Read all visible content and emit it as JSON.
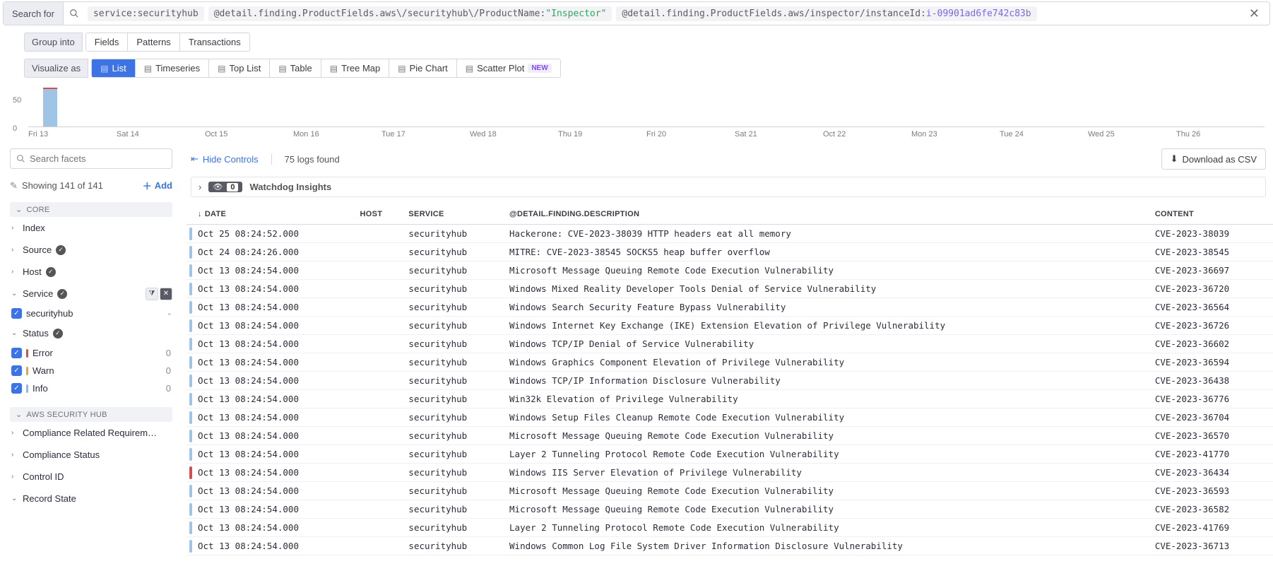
{
  "search": {
    "label": "Search for",
    "chips": [
      {
        "key": "service",
        "val": "securityhub",
        "kind": "plain"
      },
      {
        "key": "@detail.finding.ProductFields.aws\\/securityhub\\/ProductName",
        "val": "\"Inspector\"",
        "kind": "string"
      },
      {
        "key": "@detail.finding.ProductFields.aws/inspector/instanceId",
        "val": "i-09901ad6fe742c83b",
        "kind": "id"
      }
    ]
  },
  "group_into": {
    "label": "Group into",
    "items": [
      "Fields",
      "Patterns",
      "Transactions"
    ]
  },
  "visualize": {
    "label": "Visualize as",
    "items": [
      {
        "label": "List",
        "active": true
      },
      {
        "label": "Timeseries"
      },
      {
        "label": "Top List"
      },
      {
        "label": "Table"
      },
      {
        "label": "Tree Map"
      },
      {
        "label": "Pie Chart"
      },
      {
        "label": "Scatter Plot",
        "new": true
      }
    ]
  },
  "chart_data": {
    "type": "bar",
    "categories": [
      "Fri 13",
      "Sat 14",
      "Oct 15",
      "Mon 16",
      "Tue 17",
      "Wed 18",
      "Thu 19",
      "Fri 20",
      "Sat 21",
      "Oct 22",
      "Mon 23",
      "Tue 24",
      "Wed 25",
      "Thu 26"
    ],
    "values": [
      75,
      0,
      0,
      0,
      0,
      0,
      0,
      0,
      0,
      0,
      0,
      0,
      0,
      0
    ],
    "ylim": [
      0,
      75
    ],
    "yticks": [
      0,
      50
    ],
    "title": "",
    "xlabel": "",
    "ylabel": ""
  },
  "sidebar": {
    "facet_search_ph": "Search facets",
    "showing": "Showing 141 of 141",
    "add_label": "Add",
    "sections": {
      "core": "CORE",
      "aws": "AWS SECURITY HUB"
    },
    "core_facets": [
      "Index",
      "Source",
      "Host",
      "Service",
      "Status"
    ],
    "service_value": {
      "name": "securityhub",
      "count": "-"
    },
    "status_values": [
      {
        "name": "Error",
        "cls": "sb-error",
        "count": "0"
      },
      {
        "name": "Warn",
        "cls": "sb-warn",
        "count": "0"
      },
      {
        "name": "Info",
        "cls": "sb-info",
        "count": "0"
      }
    ],
    "aws_facets": [
      "Compliance Related Requirem…",
      "Compliance Status",
      "Control ID",
      "Record State"
    ]
  },
  "content_top": {
    "hide": "Hide Controls",
    "logs_found": "75 logs found",
    "download": "Download as CSV",
    "insights_label": "Watchdog Insights",
    "insights_count": "0"
  },
  "table": {
    "headers": {
      "date": "DATE",
      "host": "HOST",
      "service": "SERVICE",
      "desc": "@DETAIL.FINDING.DESCRIPTION",
      "content": "CONTENT"
    },
    "rows": [
      {
        "sev": "info",
        "date": "Oct 25 08:24:52.000",
        "service": "securityhub",
        "desc": "Hackerone: CVE-2023-38039 HTTP headers eat all memory",
        "content": "CVE-2023-38039"
      },
      {
        "sev": "info",
        "date": "Oct 24 08:24:26.000",
        "service": "securityhub",
        "desc": "MITRE: CVE-2023-38545 SOCKS5 heap buffer overflow",
        "content": "CVE-2023-38545"
      },
      {
        "sev": "info",
        "date": "Oct 13 08:24:54.000",
        "service": "securityhub",
        "desc": "Microsoft Message Queuing Remote Code Execution Vulnerability",
        "content": "CVE-2023-36697"
      },
      {
        "sev": "info",
        "date": "Oct 13 08:24:54.000",
        "service": "securityhub",
        "desc": "Windows Mixed Reality Developer Tools Denial of Service Vulnerability",
        "content": "CVE-2023-36720"
      },
      {
        "sev": "info",
        "date": "Oct 13 08:24:54.000",
        "service": "securityhub",
        "desc": "Windows Search Security Feature Bypass Vulnerability",
        "content": "CVE-2023-36564"
      },
      {
        "sev": "info",
        "date": "Oct 13 08:24:54.000",
        "service": "securityhub",
        "desc": "Windows Internet Key Exchange (IKE) Extension Elevation of Privilege Vulnerability",
        "content": "CVE-2023-36726"
      },
      {
        "sev": "info",
        "date": "Oct 13 08:24:54.000",
        "service": "securityhub",
        "desc": "Windows TCP/IP Denial of Service Vulnerability",
        "content": "CVE-2023-36602"
      },
      {
        "sev": "info",
        "date": "Oct 13 08:24:54.000",
        "service": "securityhub",
        "desc": "Windows Graphics Component Elevation of Privilege Vulnerability",
        "content": "CVE-2023-36594"
      },
      {
        "sev": "info",
        "date": "Oct 13 08:24:54.000",
        "service": "securityhub",
        "desc": "Windows TCP/IP Information Disclosure Vulnerability",
        "content": "CVE-2023-36438"
      },
      {
        "sev": "info",
        "date": "Oct 13 08:24:54.000",
        "service": "securityhub",
        "desc": "Win32k Elevation of Privilege Vulnerability",
        "content": "CVE-2023-36776"
      },
      {
        "sev": "info",
        "date": "Oct 13 08:24:54.000",
        "service": "securityhub",
        "desc": "Windows Setup Files Cleanup Remote Code Execution Vulnerability",
        "content": "CVE-2023-36704"
      },
      {
        "sev": "info",
        "date": "Oct 13 08:24:54.000",
        "service": "securityhub",
        "desc": "Microsoft Message Queuing Remote Code Execution Vulnerability",
        "content": "CVE-2023-36570"
      },
      {
        "sev": "info",
        "date": "Oct 13 08:24:54.000",
        "service": "securityhub",
        "desc": "Layer 2 Tunneling Protocol Remote Code Execution Vulnerability",
        "content": "CVE-2023-41770"
      },
      {
        "sev": "error",
        "date": "Oct 13 08:24:54.000",
        "service": "securityhub",
        "desc": "Windows IIS Server Elevation of Privilege Vulnerability",
        "content": "CVE-2023-36434"
      },
      {
        "sev": "info",
        "date": "Oct 13 08:24:54.000",
        "service": "securityhub",
        "desc": "Microsoft Message Queuing Remote Code Execution Vulnerability",
        "content": "CVE-2023-36593"
      },
      {
        "sev": "info",
        "date": "Oct 13 08:24:54.000",
        "service": "securityhub",
        "desc": "Microsoft Message Queuing Remote Code Execution Vulnerability",
        "content": "CVE-2023-36582"
      },
      {
        "sev": "info",
        "date": "Oct 13 08:24:54.000",
        "service": "securityhub",
        "desc": "Layer 2 Tunneling Protocol Remote Code Execution Vulnerability",
        "content": "CVE-2023-41769"
      },
      {
        "sev": "info",
        "date": "Oct 13 08:24:54.000",
        "service": "securityhub",
        "desc": "Windows Common Log File System Driver Information Disclosure Vulnerability",
        "content": "CVE-2023-36713"
      }
    ]
  }
}
